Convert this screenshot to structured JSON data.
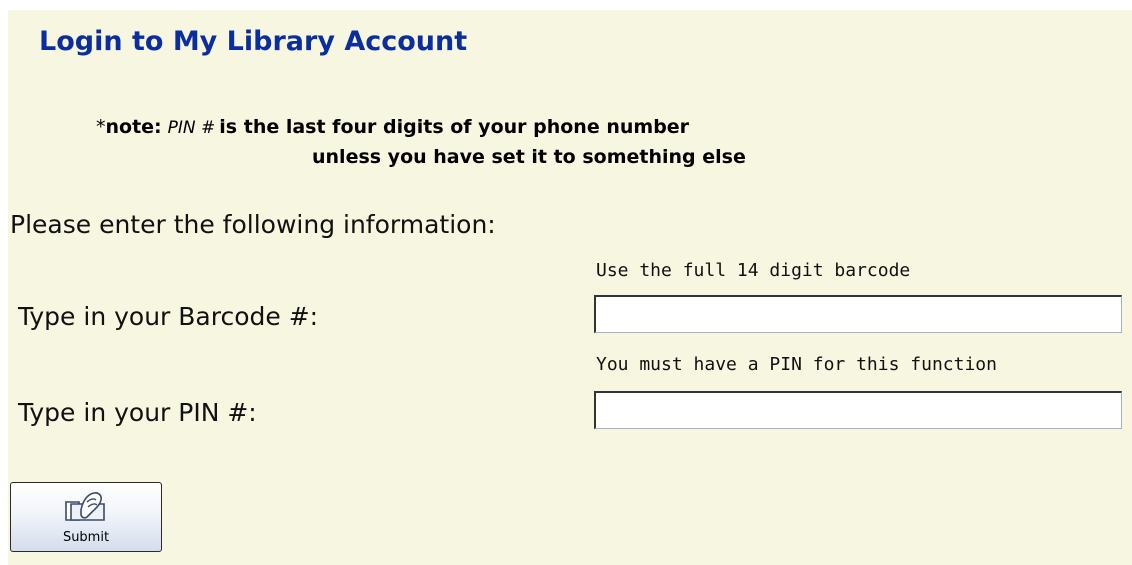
{
  "page": {
    "title": "Login to My Library Account",
    "note": {
      "prefix": "*",
      "lead": "note:",
      "pin_term": "PIN #",
      "line1_rest": "is the last four digits of your phone number",
      "line2": "unless you have set it to something else"
    },
    "instructions": "Please enter the following information:"
  },
  "form": {
    "barcode": {
      "hint": "Use the full 14 digit barcode",
      "label": "Type in your Barcode #:",
      "value": ""
    },
    "pin": {
      "hint": "You must have a PIN for this function",
      "label": "Type in your PIN #:",
      "value": ""
    },
    "submit_label": "Submit",
    "submit_icon": "hand-pointer-icon"
  },
  "colors": {
    "panel_background": "#f7f6e1",
    "title_blue": "#0a2e9e",
    "button_gradient_bottom": "#d4dded"
  }
}
